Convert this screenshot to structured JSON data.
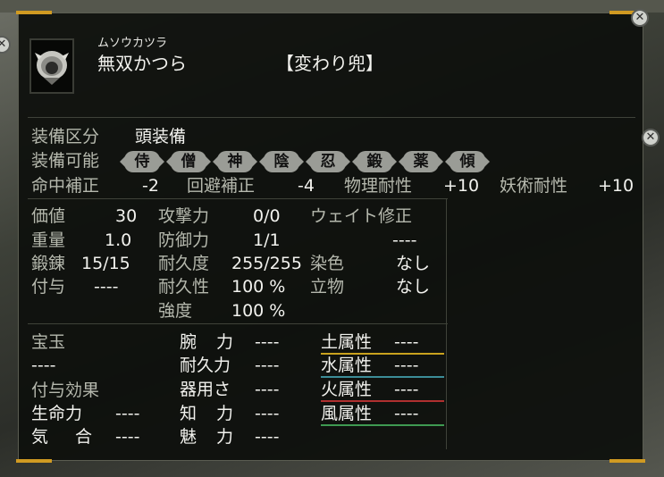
{
  "item": {
    "reading": "ムソウカツラ",
    "name": "無双かつら",
    "category": "【変わり兜】"
  },
  "equip": {
    "slot_label": "装備区分",
    "slot_value": "頭装備",
    "usable_label": "装備可能",
    "classes": [
      "侍",
      "僧",
      "神",
      "陰",
      "忍",
      "鍛",
      "薬",
      "傾"
    ]
  },
  "modifiers": [
    {
      "label": "命中補正",
      "value": "-2"
    },
    {
      "label": "回避補正",
      "value": "-4"
    },
    {
      "label": "物理耐性",
      "value": "+10"
    },
    {
      "label": "妖術耐性",
      "value": "+10"
    }
  ],
  "stats": {
    "value_label": "価値",
    "value": "30",
    "weight_label": "重量",
    "weight": "1.0",
    "forge_label": "鍛錬",
    "forge": "15/15",
    "enchant_label": "付与",
    "enchant": "----",
    "attack_label": "攻撃力",
    "attack": "0/0",
    "defense_label": "防御力",
    "defense": "1/1",
    "durability_label": "耐久度",
    "durability": "255/255",
    "endurance_label": "耐久性",
    "endurance": "100 %",
    "strength_label": "強度",
    "strength": "100 %",
    "weight_mod_label": "ウェイト修正",
    "weight_mod": "----",
    "dye_label": "染色",
    "dye": "なし",
    "crest_label": "立物",
    "crest": "なし"
  },
  "gems": {
    "label": "宝玉",
    "value": "----"
  },
  "effects": {
    "label": "付与効果",
    "hp_label": "生命力",
    "hp": "----",
    "ki_label": "気 合",
    "ki": "----"
  },
  "attributes": [
    {
      "label": "腕 力",
      "value": "----"
    },
    {
      "label": "耐久力",
      "value": "----"
    },
    {
      "label": "器用さ",
      "value": "----"
    },
    {
      "label": "知 力",
      "value": "----"
    },
    {
      "label": "魅 力",
      "value": "----"
    }
  ],
  "elements": [
    {
      "label": "土属性",
      "value": "----",
      "color": "#c9a21e"
    },
    {
      "label": "水属性",
      "value": "----",
      "color": "#3c8d98"
    },
    {
      "label": "火属性",
      "value": "----",
      "color": "#b03030"
    },
    {
      "label": "風属性",
      "value": "----",
      "color": "#3f9a52"
    }
  ],
  "colors": {
    "accent": "#d09a22",
    "panel": "#0e100d",
    "badge": "#9a9c96"
  },
  "icons": {
    "close": "close-icon",
    "portrait": "wig-item-icon"
  }
}
